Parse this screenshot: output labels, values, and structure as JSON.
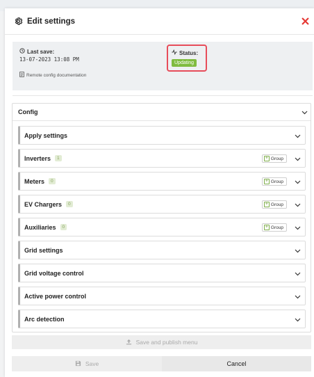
{
  "modal": {
    "title": "Edit settings",
    "close_icon": "close-icon",
    "accent_close": "#e53935"
  },
  "info": {
    "last_save_label": "Last save:",
    "last_save_value": "13-07-2023 13:08 PM",
    "docs_link": "Remote config documentation",
    "status_label": "Status:",
    "status_value": "Updating",
    "status_color": "#7fbc3f",
    "status_highlight": "#e74c5a"
  },
  "config": {
    "title": "Config",
    "group_label": "Group",
    "sections": [
      {
        "label": "Apply settings"
      },
      {
        "label": "Inverters",
        "count": "1"
      },
      {
        "label": "Meters",
        "count": "0"
      },
      {
        "label": "EV Chargers",
        "count": "0"
      },
      {
        "label": "Auxiliaries",
        "count": "0"
      },
      {
        "label": "Grid settings"
      },
      {
        "label": "Grid voltage control"
      },
      {
        "label": "Active power control"
      },
      {
        "label": "Arc detection"
      }
    ]
  },
  "footer": {
    "publish_label": "Save and publish menu",
    "save_label": "Save",
    "cancel_label": "Cancel"
  }
}
